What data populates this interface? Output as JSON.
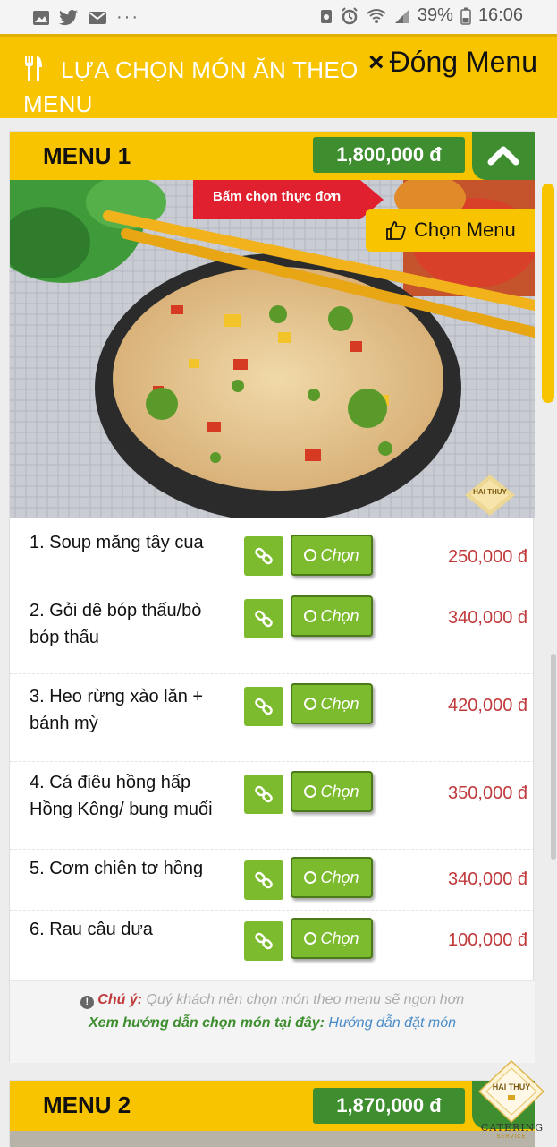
{
  "status_bar": {
    "battery": "39%",
    "time": "16:06",
    "left_icons": [
      "image-icon",
      "twitter-icon",
      "mail-icon",
      "more-icon"
    ],
    "right_icons": [
      "data-saver-icon",
      "alarm-icon",
      "wifi-icon",
      "signal-icon"
    ]
  },
  "header": {
    "title": "LỰA CHỌN MÓN ĂN THEO MENU",
    "close_label": "Đóng Menu",
    "close_icon": "×"
  },
  "menu1": {
    "name": "MENU 1",
    "price": "1,800,000 đ",
    "callout": "Bấm chọn thực đơn",
    "choose_label": "Chọn Menu",
    "logo_text": "HAI THUY",
    "items": [
      {
        "name": "1. Soup măng tây cua",
        "pick": "Chọn",
        "price": "250,000 đ"
      },
      {
        "name": "2. Gỏi dê bóp thấu/bò bóp thấu",
        "pick": "Chọn",
        "price": "340,000 đ"
      },
      {
        "name": "3. Heo rừng xào lăn + bánh mỳ",
        "pick": "Chọn",
        "price": "420,000 đ"
      },
      {
        "name": "4. Cá điêu hồng hấp Hồng Kông/ bung muối",
        "pick": "Chọn",
        "price": "350,000 đ"
      },
      {
        "name": "5. Cơm chiên tơ hồng",
        "pick": "Chọn",
        "price": "340,000 đ"
      },
      {
        "name": "6. Rau câu dưa",
        "pick": "Chọn",
        "price": "100,000 đ"
      }
    ],
    "note": {
      "label": "Chú ý:",
      "text": "Quý khách nên chọn món theo menu sẽ ngon hơn",
      "guide_label": "Xem hướng dẫn chọn món tại đây:",
      "guide_link": "Hướng dẫn đặt món"
    }
  },
  "menu2": {
    "name": "MENU 2",
    "price": "1,870,000 đ"
  },
  "brand": {
    "logo_text": "HAI THUY",
    "name": "CATERING",
    "tagline": "SERVICE"
  },
  "colors": {
    "accent_yellow": "#f8c400",
    "green_dark": "#3e8e2f",
    "green_button": "#7cba2e",
    "price_red": "#c0393b",
    "callout_red": "#e0202e"
  }
}
